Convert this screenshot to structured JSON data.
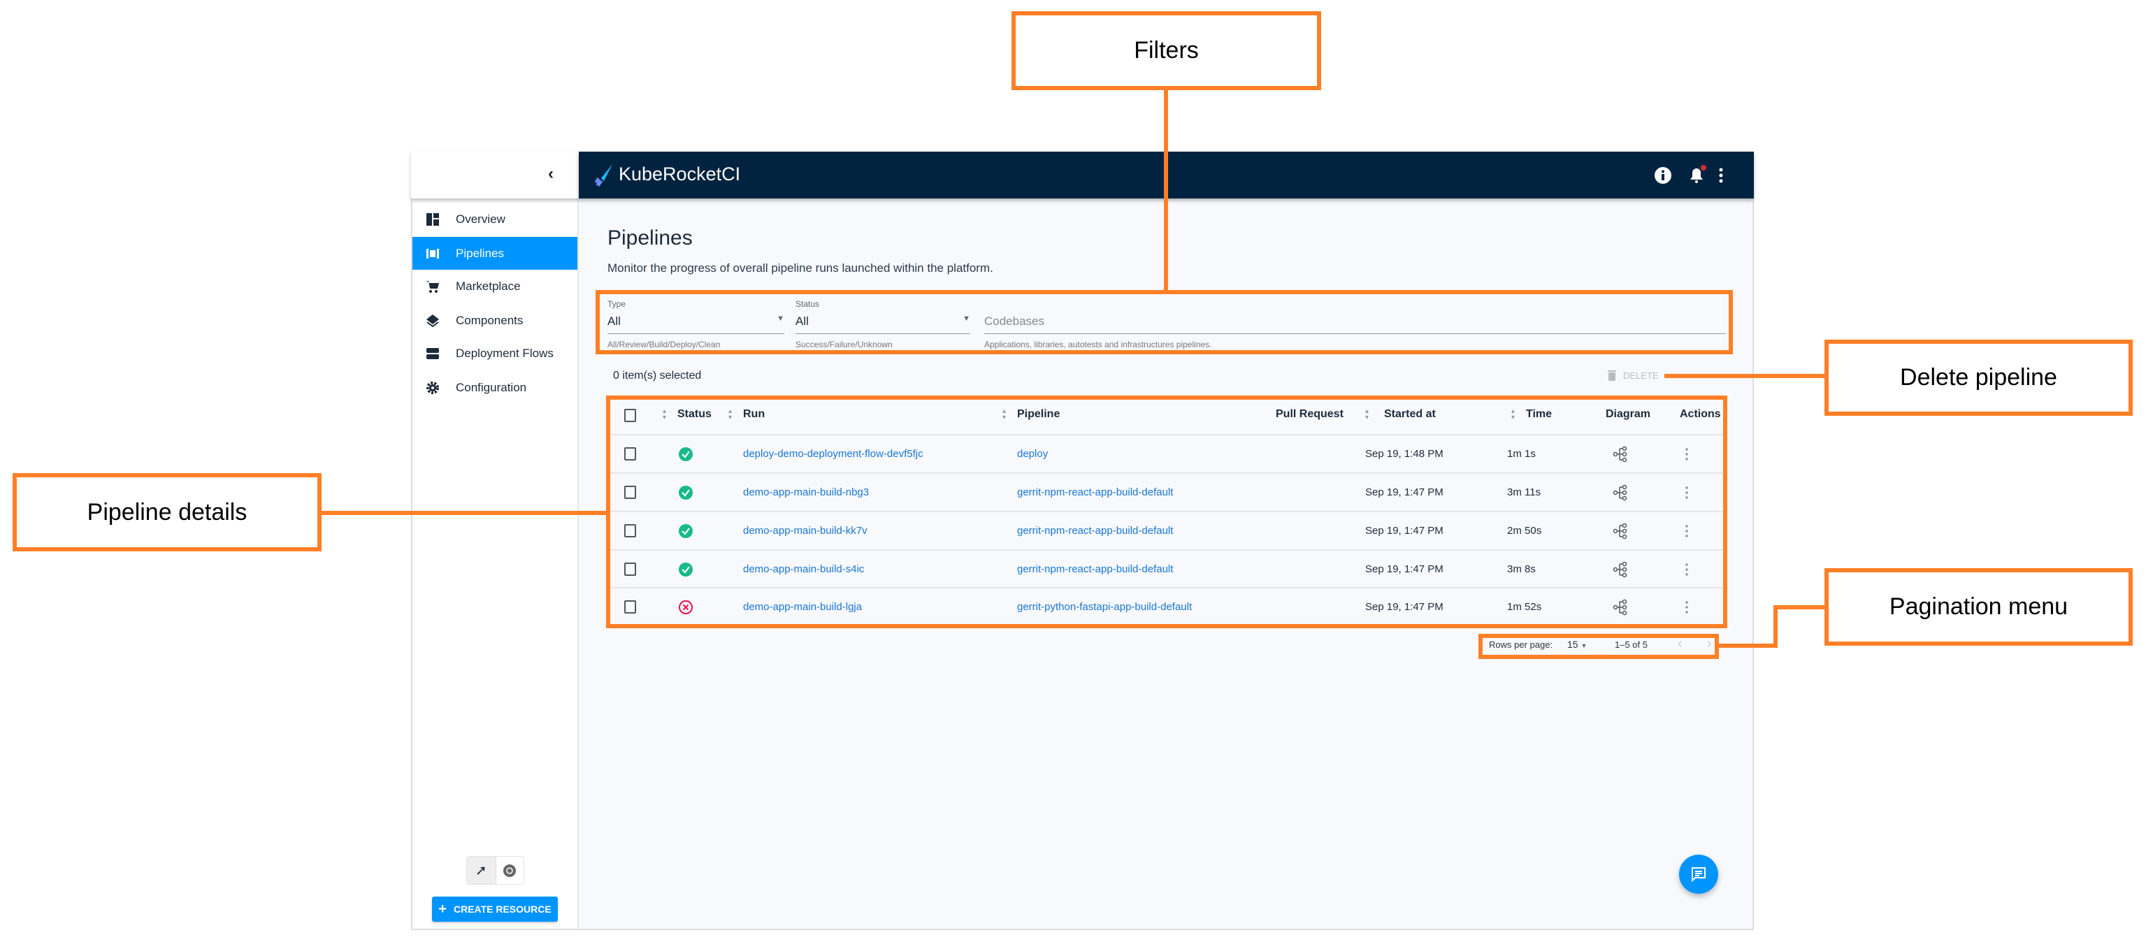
{
  "app": {
    "title": "KubeRocketCI"
  },
  "sidebar": {
    "items": [
      {
        "label": "Overview",
        "icon": "dashboard-icon",
        "active": false
      },
      {
        "label": "Pipelines",
        "icon": "pipelines-icon",
        "active": true
      },
      {
        "label": "Marketplace",
        "icon": "cart-icon",
        "active": false
      },
      {
        "label": "Components",
        "icon": "layers-icon",
        "active": false
      },
      {
        "label": "Deployment Flows",
        "icon": "deployment-flows-icon",
        "active": false
      },
      {
        "label": "Configuration",
        "icon": "gear-icon",
        "active": false
      }
    ],
    "create_label": "CREATE RESOURCE"
  },
  "page": {
    "title": "Pipelines",
    "subtitle": "Monitor the progress of overall pipeline runs launched within the platform."
  },
  "filters": {
    "type": {
      "label": "Type",
      "value": "All",
      "helper": "All/Review/Build/Deploy/Clean"
    },
    "status": {
      "label": "Status",
      "value": "All",
      "helper": "Success/Failure/Unknown"
    },
    "codebases": {
      "placeholder": "Codebases",
      "helper": "Applications, libraries, autotests and infrastructures pipelines."
    }
  },
  "selection": {
    "text": "0 item(s) selected",
    "delete_label": "DELETE"
  },
  "table": {
    "headers": {
      "status": "Status",
      "run": "Run",
      "pipeline": "Pipeline",
      "pull_request": "Pull Request",
      "started_at": "Started at",
      "time": "Time",
      "diagram": "Diagram",
      "actions": "Actions"
    },
    "rows": [
      {
        "status": "success",
        "run": "deploy-demo-deployment-flow-devf5fjc",
        "pipeline": "deploy",
        "pull_request": "",
        "started_at": "Sep 19, 1:48 PM",
        "time": "1m 1s"
      },
      {
        "status": "success",
        "run": "demo-app-main-build-nbg3",
        "pipeline": "gerrit-npm-react-app-build-default",
        "pull_request": "",
        "started_at": "Sep 19, 1:47 PM",
        "time": "3m 11s"
      },
      {
        "status": "success",
        "run": "demo-app-main-build-kk7v",
        "pipeline": "gerrit-npm-react-app-build-default",
        "pull_request": "",
        "started_at": "Sep 19, 1:47 PM",
        "time": "2m 50s"
      },
      {
        "status": "success",
        "run": "demo-app-main-build-s4ic",
        "pipeline": "gerrit-npm-react-app-build-default",
        "pull_request": "",
        "started_at": "Sep 19, 1:47 PM",
        "time": "3m 8s"
      },
      {
        "status": "failure",
        "run": "demo-app-main-build-lgja",
        "pipeline": "gerrit-python-fastapi-app-build-default",
        "pull_request": "",
        "started_at": "Sep 19, 1:47 PM",
        "time": "1m 52s"
      }
    ]
  },
  "pagination": {
    "rows_per_page_label": "Rows per page:",
    "rows_per_page": "15",
    "range": "1–5 of 5"
  },
  "callouts": {
    "filters": "Filters",
    "delete": "Delete pipeline",
    "details": "Pipeline details",
    "pagination": "Pagination menu"
  },
  "colors": {
    "header": "#02233f",
    "accent": "#0094ff",
    "link": "#1976d2",
    "success": "#18b98a",
    "failure": "#e8114d",
    "callout": "#ff7f27"
  }
}
